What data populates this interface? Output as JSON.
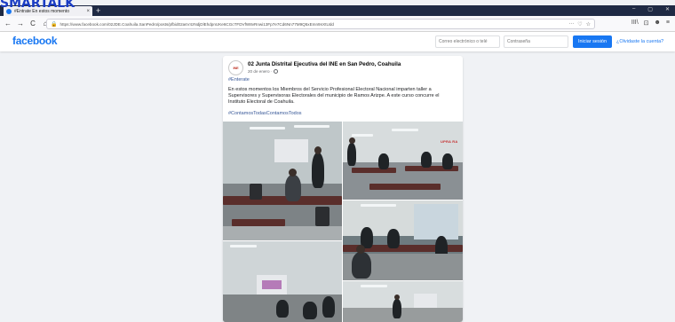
{
  "overlay": {
    "link_text": "SMARTALK"
  },
  "browser": {
    "tab_title": "#Entrate En estos momento",
    "new_tab": "+",
    "window_controls": [
      "–",
      "▢",
      "✕"
    ],
    "nav": {
      "back": "←",
      "forward": "→",
      "reload": "C",
      "home": "⌂"
    },
    "url": "https://www.facebook.com/02JDE.Coahuila.SanPedro/posts/pfbid02asV4zNdjDlEhdpnUKe6CGcTFDVfW8vRnwi13Fp7e7Cd6Nn77M9Q5xEmn9nXtUdd",
    "url_actions": [
      "···",
      "♡",
      "☆"
    ],
    "toolbar": [
      "III\\",
      "⊡",
      "☻",
      "≡"
    ]
  },
  "facebook": {
    "logo": "facebook",
    "email_placeholder": "Correo electrónico o telé",
    "password_placeholder": "Contraseña",
    "login_label": "Iniciar sesión",
    "forgot_label": "¿Olvidaste la cuenta?"
  },
  "post": {
    "avatar_text": "INE",
    "page_name": "02 Junta Distrital Ejecutiva del INE en San Pedro, Coahuila",
    "date": "20 de enero ·",
    "hashtag_top": "#Enterate",
    "body": "En estos momentos los Miembros del Servicio Profesional Electoral Nacional imparten taller a Supervisores y Supervisoras Electorales del municipio de Ramos Arizpe. A este curso concurre el Instituto Electoral de Coahuila.",
    "hashtag_bottom": "#ContamosTodasContamosTodos",
    "photo_sign": "UPRA RA"
  },
  "colors": {
    "brand": "#1877f2",
    "link": "#385898",
    "page_bg": "#f0f2f5",
    "tabstrip": "#1f2a44"
  }
}
